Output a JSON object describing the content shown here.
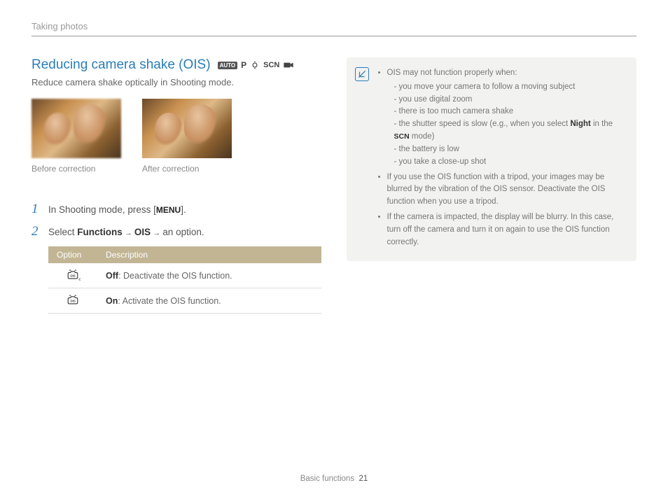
{
  "header": {
    "breadcrumb": "Taking photos"
  },
  "title": "Reducing camera shake (OIS)",
  "mode_icons": {
    "auto": "AUTO",
    "p": "P",
    "dual": "dual-is-icon",
    "scn": "SCN",
    "movie": "movie-icon"
  },
  "subtitle": "Reduce camera shake optically in Shooting mode.",
  "photos": {
    "before_caption": "Before correction",
    "after_caption": "After correction"
  },
  "steps": [
    {
      "num": "1",
      "prefix": "In Shooting mode, press [",
      "menu_label": "MENU",
      "suffix": "]."
    },
    {
      "num": "2",
      "prefix": "Select ",
      "b1": "Functions",
      "arrow1": " → ",
      "b2": "OIS",
      "arrow2": " → ",
      "suffix": "an option."
    }
  ],
  "table": {
    "headers": {
      "option": "Option",
      "description": "Description"
    },
    "rows": [
      {
        "icon": "ois-off-icon",
        "label": "Off",
        "desc": ": Deactivate the OIS function."
      },
      {
        "icon": "ois-on-icon",
        "label": "On",
        "desc": ": Activate the OIS function."
      }
    ]
  },
  "infobox": {
    "intro": "OIS may not function properly when:",
    "sub": [
      "you move your camera to follow a moving subject",
      "you use digital zoom",
      "there is too much camera shake"
    ],
    "shutter_prefix": "the shutter speed is slow (e.g., when you select ",
    "shutter_bold": "Night",
    "shutter_mid": " in the ",
    "shutter_scn": "SCN",
    "shutter_suffix": " mode)",
    "sub2": [
      "the battery is low",
      "you take a close-up shot"
    ],
    "bullets": [
      "If you use the OIS function with a tripod, your images may be blurred by the vibration of the OIS sensor. Deactivate the OIS function when you use a tripod.",
      "If the camera is impacted, the display will be blurry. In this case, turn off the camera and turn it on again to use the OIS function correctly."
    ]
  },
  "footer": {
    "section": "Basic functions",
    "page": "21"
  }
}
